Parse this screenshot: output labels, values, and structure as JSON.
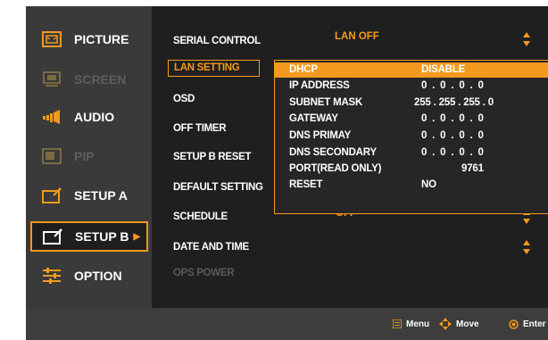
{
  "sidebar": {
    "items": [
      {
        "label": "PICTURE",
        "icon": "picture-icon",
        "state": "normal"
      },
      {
        "label": "SCREEN",
        "icon": "screen-icon",
        "state": "disabled"
      },
      {
        "label": "AUDIO",
        "icon": "audio-icon",
        "state": "normal"
      },
      {
        "label": "PIP",
        "icon": "pip-icon",
        "state": "disabled"
      },
      {
        "label": "SETUP A",
        "icon": "setup-a-icon",
        "state": "normal"
      },
      {
        "label": "SETUP B",
        "icon": "setup-b-icon",
        "state": "selected"
      },
      {
        "label": "OPTION",
        "icon": "option-icon",
        "state": "normal"
      }
    ]
  },
  "menu": {
    "rows": [
      {
        "label": "SERIAL CONTROL",
        "value": "LAN OFF"
      },
      {
        "label": "LAN SETTING",
        "value": ""
      },
      {
        "label": "OSD",
        "value": ""
      },
      {
        "label": "OFF TIMER",
        "value": ""
      },
      {
        "label": "SETUP B RESET",
        "value": ""
      },
      {
        "label": "DEFAULT SETTING",
        "value": ""
      },
      {
        "label": "SCHEDULE",
        "value": "OFF"
      },
      {
        "label": "DATE AND TIME",
        "value": ""
      },
      {
        "label": "OPS POWER",
        "value": ""
      }
    ]
  },
  "lan_popup": {
    "rows": [
      {
        "label": "DHCP",
        "value": "DISABLE"
      },
      {
        "label": "IP ADDRESS",
        "value": "0  .  0  .  0  .  0"
      },
      {
        "label": "SUBNET MASK",
        "value": "255 . 255 . 255 . 0"
      },
      {
        "label": "GATEWAY",
        "value": "0  .  0  .  0  .  0"
      },
      {
        "label": "DNS PRIMAY",
        "value": "0  .  0  .  0  .  0"
      },
      {
        "label": "DNS SECONDARY",
        "value": "0  .  0  .  0  .  0"
      },
      {
        "label": "PORT(READ ONLY)",
        "value": "9761"
      },
      {
        "label": "RESET",
        "value": "NO"
      }
    ]
  },
  "footer": {
    "menu_label": "Menu",
    "move_label": "Move",
    "enter_label": "Enter"
  },
  "colors": {
    "accent": "#f39a1e",
    "sidebar_bg": "#3a3a3a",
    "main_bg": "#1f1f1f",
    "footer_bg": "#3d3d3d"
  }
}
